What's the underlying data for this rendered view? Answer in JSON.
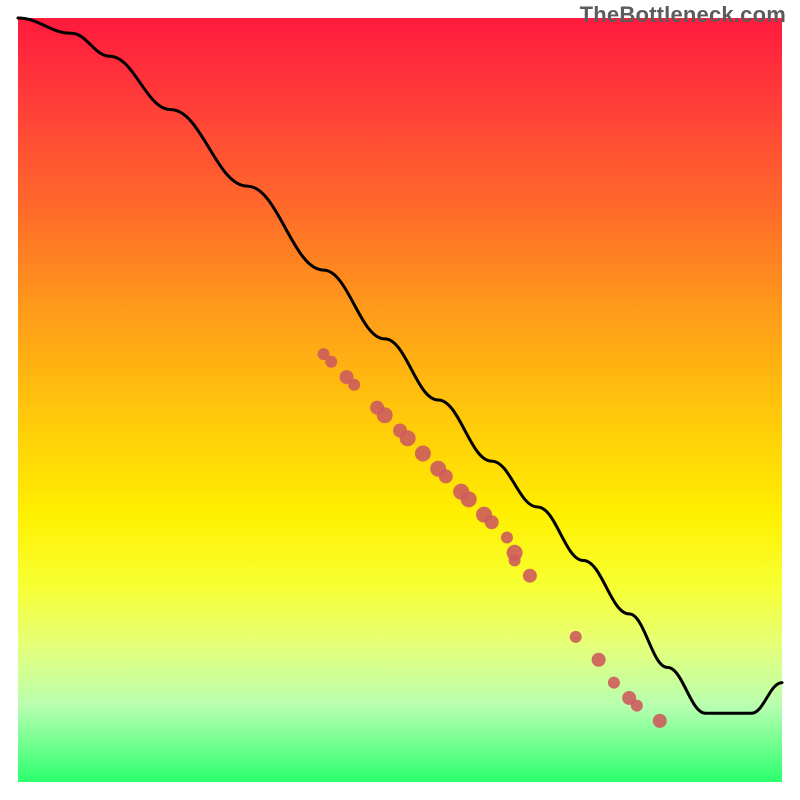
{
  "watermark": "TheBottleneck.com",
  "colors": {
    "line": "#000000",
    "dots": "#cd5c5c"
  },
  "chart_data": {
    "type": "line",
    "title": "",
    "xlabel": "",
    "ylabel": "",
    "xlim": [
      0,
      100
    ],
    "ylim": [
      0,
      100
    ],
    "grid": false,
    "legend": false,
    "x": [
      0,
      7,
      12,
      20,
      30,
      40,
      48,
      55,
      62,
      68,
      74,
      80,
      85,
      90,
      96,
      100
    ],
    "y": [
      100,
      98,
      95,
      88,
      78,
      67,
      58,
      50,
      42,
      36,
      29,
      22,
      15,
      9,
      9,
      13
    ],
    "scatter": [
      {
        "x": 40,
        "y": 56,
        "r": 6
      },
      {
        "x": 41,
        "y": 55,
        "r": 6
      },
      {
        "x": 43,
        "y": 53,
        "r": 7
      },
      {
        "x": 44,
        "y": 52,
        "r": 6
      },
      {
        "x": 47,
        "y": 49,
        "r": 7
      },
      {
        "x": 48,
        "y": 48,
        "r": 8
      },
      {
        "x": 50,
        "y": 46,
        "r": 7
      },
      {
        "x": 51,
        "y": 45,
        "r": 8
      },
      {
        "x": 53,
        "y": 43,
        "r": 8
      },
      {
        "x": 55,
        "y": 41,
        "r": 8
      },
      {
        "x": 56,
        "y": 40,
        "r": 7
      },
      {
        "x": 58,
        "y": 38,
        "r": 8
      },
      {
        "x": 59,
        "y": 37,
        "r": 8
      },
      {
        "x": 61,
        "y": 35,
        "r": 8
      },
      {
        "x": 62,
        "y": 34,
        "r": 7
      },
      {
        "x": 64,
        "y": 32,
        "r": 6
      },
      {
        "x": 65,
        "y": 30,
        "r": 8
      },
      {
        "x": 65,
        "y": 29,
        "r": 6
      },
      {
        "x": 67,
        "y": 27,
        "r": 7
      },
      {
        "x": 73,
        "y": 19,
        "r": 6
      },
      {
        "x": 76,
        "y": 16,
        "r": 7
      },
      {
        "x": 78,
        "y": 13,
        "r": 6
      },
      {
        "x": 80,
        "y": 11,
        "r": 7
      },
      {
        "x": 81,
        "y": 10,
        "r": 6
      },
      {
        "x": 84,
        "y": 8,
        "r": 7
      }
    ]
  }
}
